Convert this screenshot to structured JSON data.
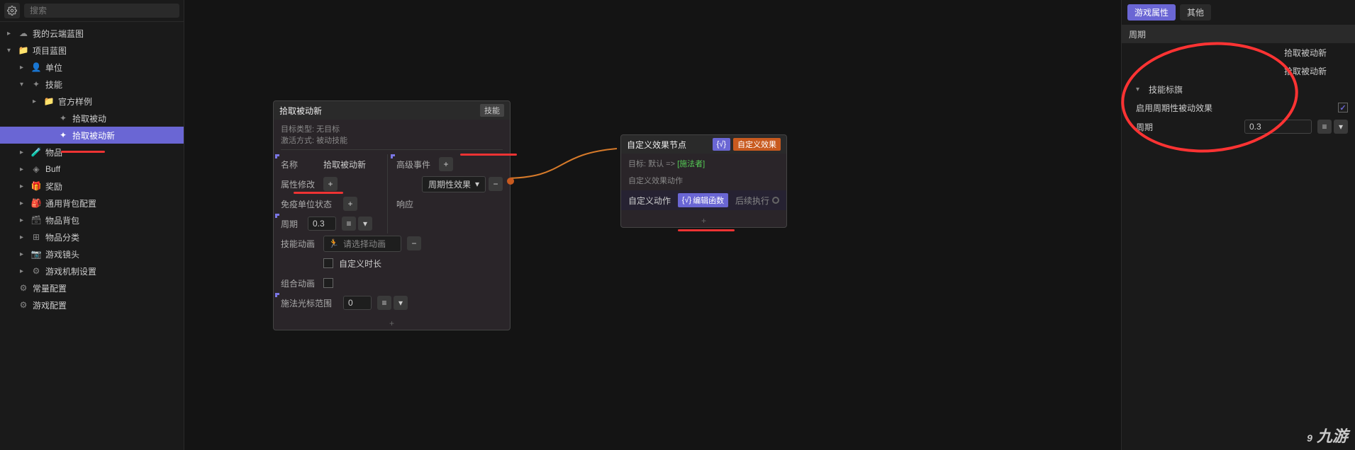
{
  "search": {
    "placeholder": "搜索"
  },
  "tree": {
    "cloud": "我的云端蓝图",
    "project": "项目蓝图",
    "unit": "单位",
    "skill": "技能",
    "sample": "官方样例",
    "pickup_passive": "拾取被动",
    "pickup_passive_new": "拾取被动新",
    "item": "物品",
    "buff": "Buff",
    "reward": "奖励",
    "bag_config": "通用背包配置",
    "item_bag": "物品背包",
    "item_category": "物品分类",
    "camera": "游戏镜头",
    "mechanism": "游戏机制设置",
    "constant": "常量配置",
    "game_config": "游戏配置"
  },
  "node1": {
    "title": "拾取被动新",
    "tag": "技能",
    "meta1_label": "目标类型:",
    "meta1_value": "无目标",
    "meta2_label": "激活方式:",
    "meta2_value": "被动技能",
    "name_label": "名称",
    "name_value": "拾取被动新",
    "adv_event": "高级事件",
    "attr_mod": "属性修改",
    "period_effect": "周期性效果",
    "immune_state": "免疫单位状态",
    "response": "响应",
    "period_label": "周期",
    "period_value": "0.3",
    "skill_anim": "技能动画",
    "select_anim": "请选择动画",
    "custom_duration": "自定义时长",
    "combo_anim": "组合动画",
    "cursor_range": "施法光标范围",
    "cursor_value": "0"
  },
  "node2": {
    "title": "自定义效果节点",
    "tag": "自定义效果",
    "target_label": "目标:",
    "target_default": "默认 =>",
    "target_caster": "[施法者]",
    "effect_action": "自定义效果动作",
    "custom_action": "自定义动作",
    "edit_function": "编辑函数",
    "follow_exec": "后续执行"
  },
  "props": {
    "tab_game": "游戏属性",
    "tab_other": "其他",
    "period_header": "周期",
    "pickup_new": "拾取被动新",
    "skill_flag": "技能标旗",
    "enable_periodic": "启用周期性被动效果",
    "period_label": "周期",
    "period_value": "0.3"
  },
  "watermark": "九游"
}
